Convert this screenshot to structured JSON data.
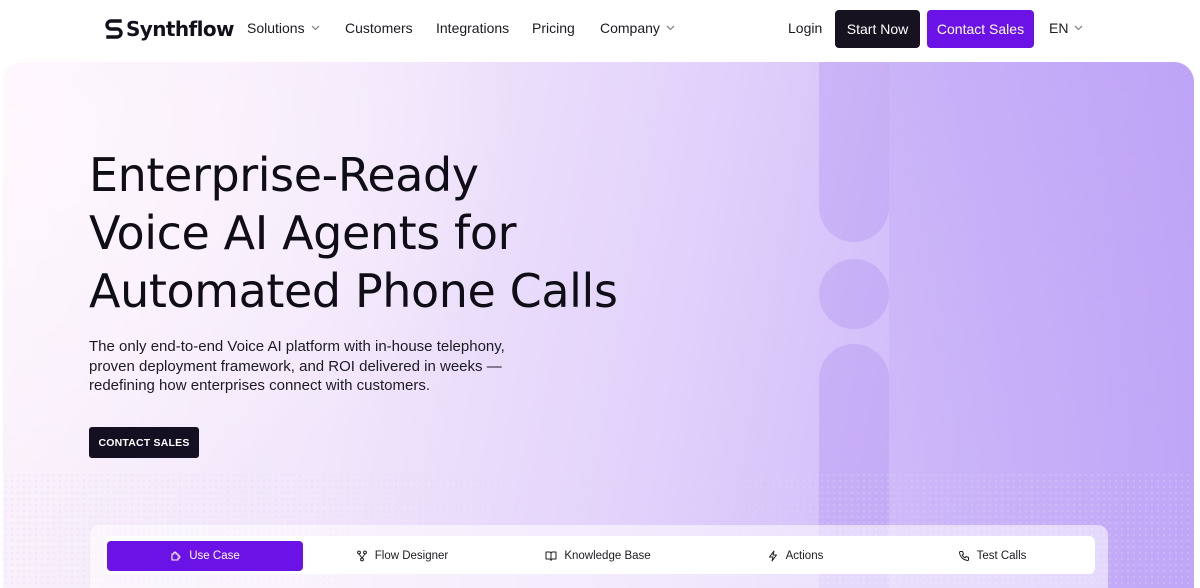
{
  "nav": {
    "logo_text": "Synthflow",
    "items": [
      {
        "label": "Solutions",
        "has_dropdown": true
      },
      {
        "label": "Customers",
        "has_dropdown": false
      },
      {
        "label": "Integrations",
        "has_dropdown": false
      },
      {
        "label": "Pricing",
        "has_dropdown": false
      },
      {
        "label": "Company",
        "has_dropdown": true
      }
    ],
    "login_label": "Login",
    "start_label": "Start Now",
    "contact_label": "Contact Sales",
    "language": "EN"
  },
  "hero": {
    "title_lines": [
      "Enterprise-Ready",
      "Voice AI Agents for",
      "Automated Phone Calls"
    ],
    "subtitle_lines": [
      "The only end-to-end Voice AI platform with in-house telephony,",
      "proven deployment framework, and ROI delivered in weeks —",
      "redefining how enterprises connect with customers."
    ],
    "cta_label": "CONTACT SALES"
  },
  "tabs": [
    {
      "label": "Use Case",
      "icon": "puzzle-icon",
      "active": true
    },
    {
      "label": "Flow Designer",
      "icon": "flow-icon",
      "active": false
    },
    {
      "label": "Knowledge Base",
      "icon": "book-icon",
      "active": false
    },
    {
      "label": "Actions",
      "icon": "lightning-icon",
      "active": false
    },
    {
      "label": "Test Calls",
      "icon": "phone-icon",
      "active": false
    }
  ],
  "colors": {
    "accent": "#6b12e6",
    "dark_button": "#16121f",
    "hero_gradient_start": "#fbf3fb",
    "hero_gradient_end": "#bfa5f7"
  }
}
